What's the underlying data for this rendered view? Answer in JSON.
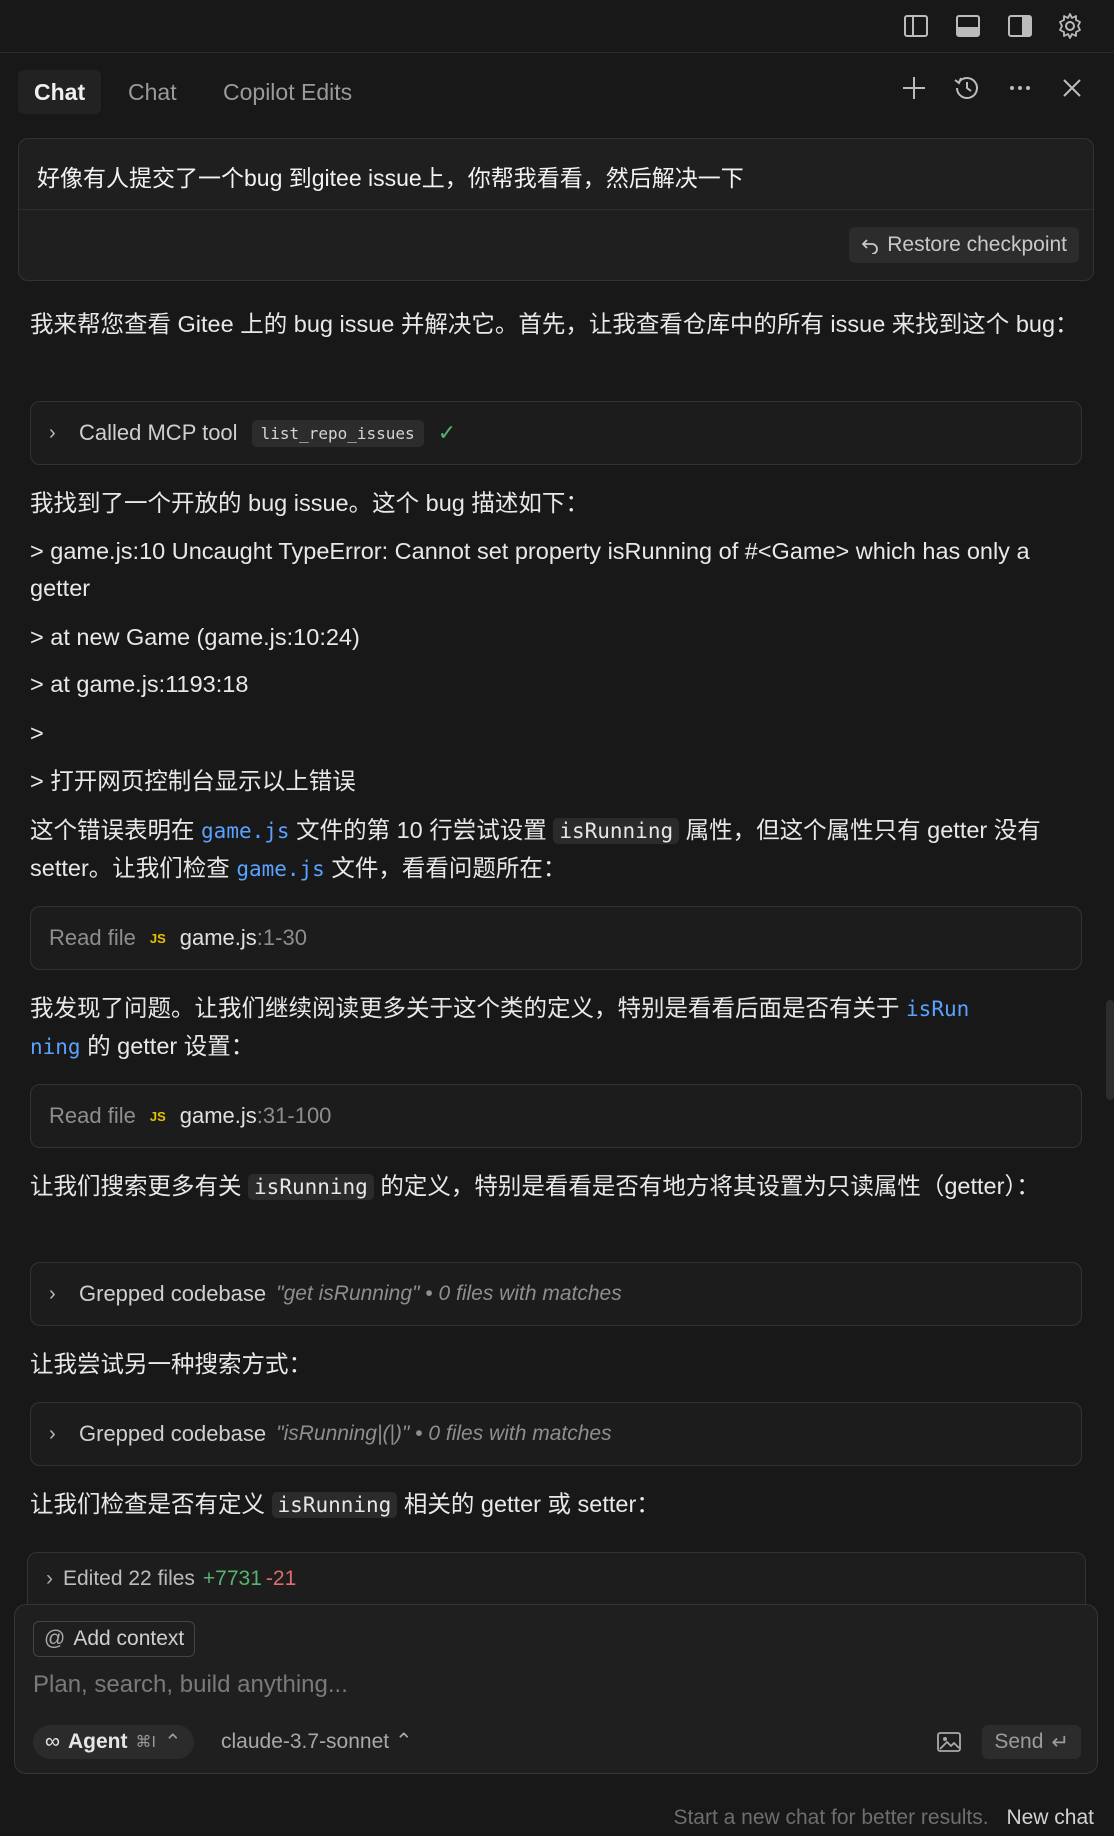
{
  "header": {
    "tabs": [
      {
        "label": "Chat",
        "active": true
      },
      {
        "label": "Chat",
        "active": false
      },
      {
        "label": "Copilot Edits",
        "active": false
      }
    ],
    "icons": [
      "layout-sidebar-left-icon",
      "layout-panel-icon",
      "layout-sidebar-right-icon",
      "gear-icon",
      "plus-icon",
      "history-icon",
      "more-icon",
      "close-icon"
    ]
  },
  "user_message": {
    "text": "好像有人提交了一个bug 到gitee issue上，你帮我看看，然后解决一下",
    "restore_label": "Restore checkpoint"
  },
  "conversation": {
    "p1": "我来帮您查看 Gitee 上的 bug issue 并解决它。首先，让我查看仓库中的所有 issue 来找到这个 bug：",
    "tool1": {
      "label": "Called MCP tool",
      "tool": "list_repo_issues"
    },
    "p2": "我找到了一个开放的 bug issue。这个 bug 描述如下：",
    "q1": "> game.js:10 Uncaught TypeError: Cannot set property isRunning of #<Game> which has only a getter",
    "q2": "> at new Game (game.js:10:24)",
    "q3": "> at game.js:1193:18",
    "q4": ">",
    "q5": "> 打开网页控制台显示以上错误",
    "p3": {
      "a": "这个错误表明在 ",
      "code1": "game.js",
      "b": " 文件的第 10 行尝试设置 ",
      "code2": "isRunning",
      "c": " 属性，但这个属性只有 getter 没有 setter。让我们检查 ",
      "code3": "game.js",
      "d": " 文件，看看问题所在："
    },
    "read1": {
      "label": "Read file",
      "file": "game.js",
      "range": ":1-30"
    },
    "p4": {
      "a": "我发现了问题。让我们继续阅读更多关于这个类的定义，特别是看看后面是否有关于 ",
      "code1": "isRun",
      "code1b": "ning",
      "b": " 的 getter 设置："
    },
    "read2": {
      "label": "Read file",
      "file": "game.js",
      "range": ":31-100"
    },
    "p5": {
      "a": "让我们搜索更多有关 ",
      "code1": "isRunning",
      "b": " 的定义，特别是看看是否有地方将其设置为只读属性（getter）："
    },
    "grep1": {
      "label": "Grepped codebase",
      "query": "\"get isRunning\" • 0 files with matches"
    },
    "p6": "让我尝试另一种搜索方式：",
    "grep2": {
      "label": "Grepped codebase",
      "query": "\"isRunning|(|)\" • 0 files with matches"
    },
    "p7": {
      "a": "让我们检查是否有定义 ",
      "code1": "isRunning",
      "b": " 相关的 getter 或 setter："
    }
  },
  "edited": {
    "label": "Edited 22 files",
    "added": "+7731",
    "removed": "-21"
  },
  "composer": {
    "add_context": "Add context",
    "placeholder": "Plan, search, build anything...",
    "mode": "Agent",
    "mode_shortcut": "⌘I",
    "model": "claude-3.7-sonnet",
    "send": "Send"
  },
  "footer": {
    "hint": "Start a new chat for better results.",
    "new_chat": "New chat"
  },
  "colors": {
    "background": "#181818",
    "link": "#5aa2ff",
    "added": "#56b46f",
    "removed": "#e06c6c",
    "js_badge": "#e5c100"
  }
}
